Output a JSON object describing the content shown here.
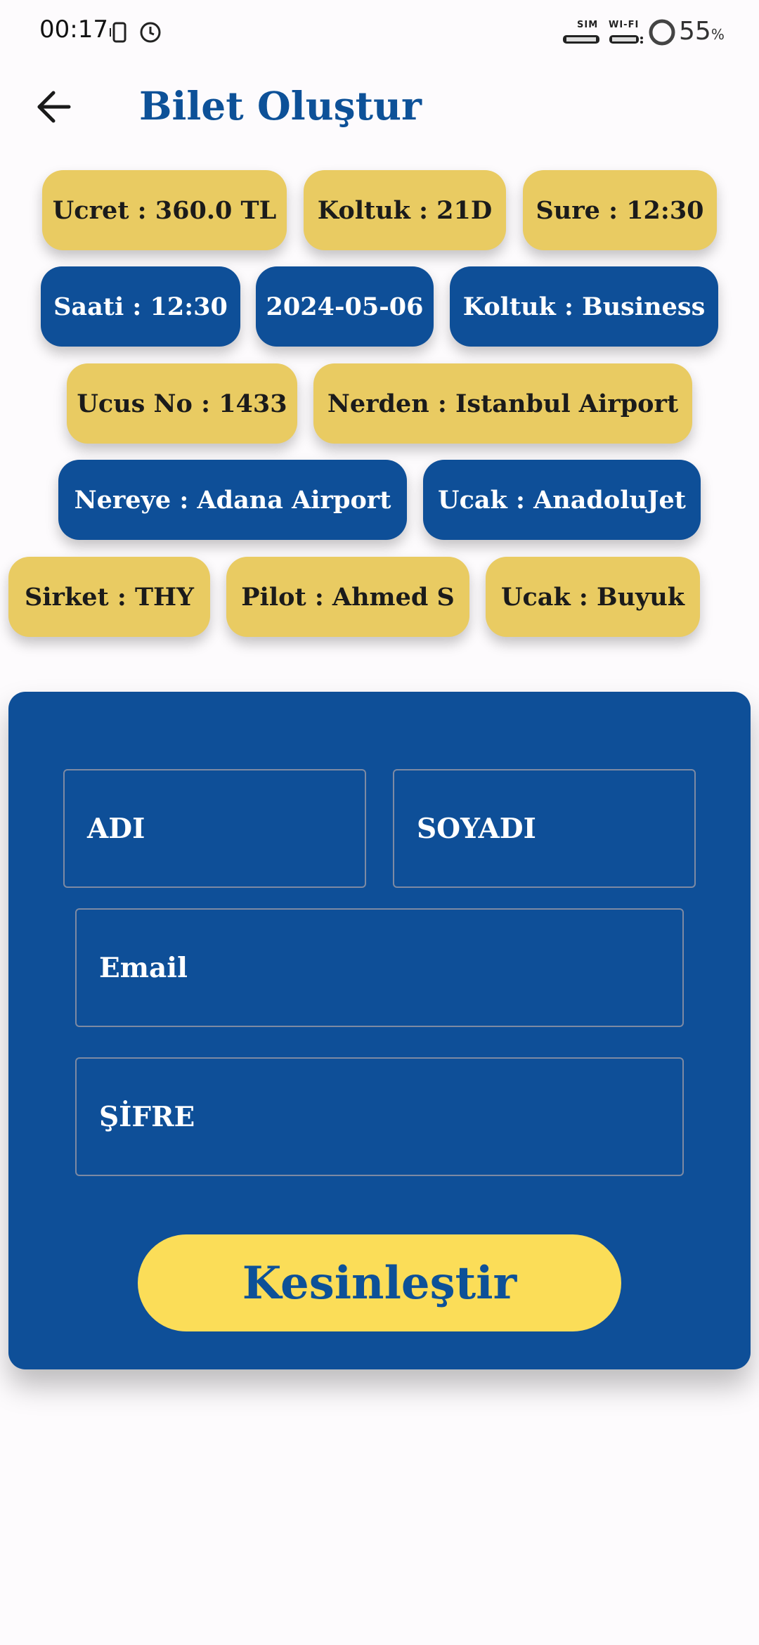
{
  "status_bar": {
    "time": "00:17",
    "sim_label": "SIM",
    "wifi_label": "WI-FI",
    "battery_value": "55",
    "battery_unit": "%"
  },
  "app_bar": {
    "back_icon": "arrow-left-icon",
    "title": "Bilet Oluştur"
  },
  "chips": [
    {
      "text": "Ucret : 360.0 TL",
      "color": "#e9cb62"
    },
    {
      "text": "Koltuk : 21D",
      "color": "#e9cb62"
    },
    {
      "text": "Sure : 12:30",
      "color": "#e9cb62"
    },
    {
      "text": "Saati : 12:30",
      "color": "#0e4f98"
    },
    {
      "text": "2024-05-06",
      "color": "#0e4f98"
    },
    {
      "text": "Koltuk : Business",
      "color": "#0e4f98"
    },
    {
      "text": "Ucus No : 1433",
      "color": "#e9cb62"
    },
    {
      "text": "Nerden : Istanbul Airport",
      "color": "#e9cb62"
    },
    {
      "text": "Nereye : Adana Airport",
      "color": "#0e4f98"
    },
    {
      "text": "Ucak : AnadoluJet",
      "color": "#0e4f98"
    },
    {
      "text": "Sirket : THY",
      "color": "#e9cb62"
    },
    {
      "text": "Pilot : Ahmed S",
      "color": "#e9cb62"
    },
    {
      "text": "Ucak : Buyuk",
      "color": "#e9cb62"
    }
  ],
  "form": {
    "first_name_placeholder": "ADI",
    "last_name_placeholder": "SOYADI",
    "email_placeholder": "Email",
    "password_placeholder": "ŞİFRE",
    "submit_label": "Kesinleştir"
  },
  "colors": {
    "primary": "#0e4f98",
    "chip_yellow": "#e9cb62",
    "button_yellow": "#fbdd58"
  }
}
